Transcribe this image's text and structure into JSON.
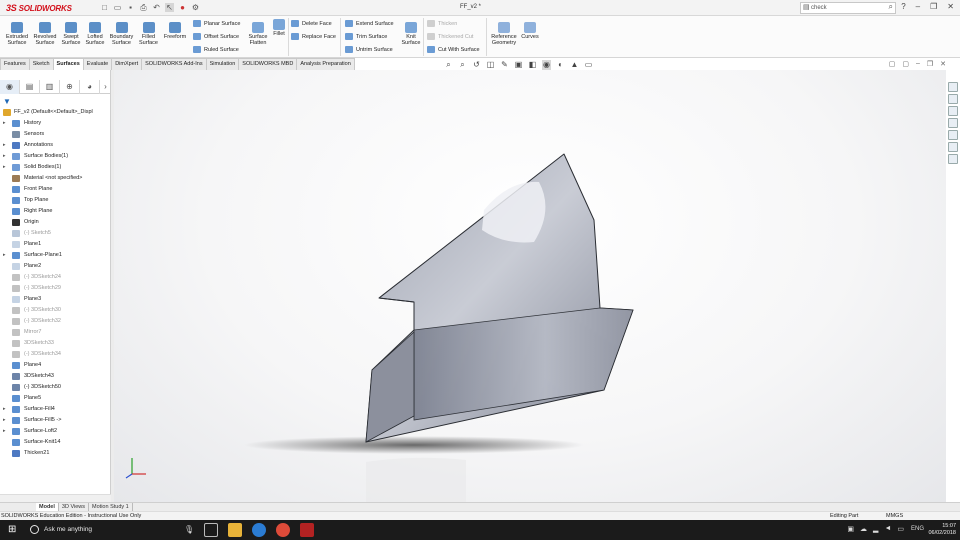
{
  "titlebar": {
    "brand": "SOLIDWORKS",
    "document_title": "FF_v2 *",
    "search_value": "check"
  },
  "ribbon": {
    "big_buttons": [
      {
        "label": "Extruded Surface"
      },
      {
        "label": "Revolved Surface"
      },
      {
        "label": "Swept Surface"
      },
      {
        "label": "Lofted Surface"
      },
      {
        "label": "Boundary Surface"
      },
      {
        "label": "Filled Surface"
      },
      {
        "label": "Freeform"
      }
    ],
    "col1": [
      "Planar Surface",
      "Offset Surface",
      "Ruled Surface"
    ],
    "flatten": "Surface Flatten",
    "fillet": "Fillet",
    "col2": [
      "Delete Face",
      "Replace Face"
    ],
    "col3": [
      "Extend Surface",
      "Trim Surface",
      "Untrim Surface"
    ],
    "knit": "Knit Surface",
    "col4": [
      "Thicken",
      "Thickened Cut",
      "Cut With Surface"
    ],
    "refgeom": "Reference Geometry",
    "curves": "Curves"
  },
  "tabs": [
    "Features",
    "Sketch",
    "Surfaces",
    "Evaluate",
    "DimXpert",
    "SOLIDWORKS Add-Ins",
    "Simulation",
    "SOLIDWORKS MBD",
    "Analysis Preparation"
  ],
  "active_tab": "Surfaces",
  "tree": {
    "root": "FF_v2  (Default<<Default>_Displ",
    "items": [
      {
        "label": "History",
        "dim": false,
        "expand": true,
        "icon": "history"
      },
      {
        "label": "Sensors",
        "dim": false,
        "expand": false,
        "icon": "sensor"
      },
      {
        "label": "Annotations",
        "dim": false,
        "expand": true,
        "icon": "annotation"
      },
      {
        "label": "Surface Bodies(1)",
        "dim": false,
        "expand": true,
        "icon": "surface-bodies"
      },
      {
        "label": "Solid Bodies(1)",
        "dim": false,
        "expand": true,
        "icon": "solid-bodies"
      },
      {
        "label": "Material <not specified>",
        "dim": false,
        "expand": false,
        "icon": "material"
      },
      {
        "label": "Front Plane",
        "dim": false,
        "expand": false,
        "icon": "plane"
      },
      {
        "label": "Top Plane",
        "dim": false,
        "expand": false,
        "icon": "plane"
      },
      {
        "label": "Right Plane",
        "dim": false,
        "expand": false,
        "icon": "plane"
      },
      {
        "label": "Origin",
        "dim": false,
        "expand": false,
        "icon": "origin"
      },
      {
        "label": "(-) Sketch5",
        "dim": true,
        "expand": false,
        "icon": "sketch"
      },
      {
        "label": "Plane1",
        "dim": false,
        "expand": false,
        "icon": "plane-outline"
      },
      {
        "label": "Surface-Plane1",
        "dim": false,
        "expand": true,
        "icon": "surface"
      },
      {
        "label": "Plane2",
        "dim": false,
        "expand": false,
        "icon": "plane-outline"
      },
      {
        "label": "(-) 3DSketch24",
        "dim": true,
        "expand": false,
        "icon": "3dsketch"
      },
      {
        "label": "(-) 3DSketch29",
        "dim": true,
        "expand": false,
        "icon": "3dsketch"
      },
      {
        "label": "Plane3",
        "dim": false,
        "expand": false,
        "icon": "plane-outline"
      },
      {
        "label": "(-) 3DSketch30",
        "dim": true,
        "expand": false,
        "icon": "3dsketch"
      },
      {
        "label": "(-) 3DSketch32",
        "dim": true,
        "expand": false,
        "icon": "3dsketch"
      },
      {
        "label": "Mirror7",
        "dim": true,
        "expand": false,
        "icon": "mirror"
      },
      {
        "label": "3DSketch33",
        "dim": true,
        "expand": false,
        "icon": "3dsketch"
      },
      {
        "label": "(-) 3DSketch34",
        "dim": true,
        "expand": false,
        "icon": "3dsketch"
      },
      {
        "label": "Plane4",
        "dim": false,
        "expand": false,
        "icon": "plane"
      },
      {
        "label": "3DSketch43",
        "dim": false,
        "expand": false,
        "icon": "3dsketch-active"
      },
      {
        "label": "(-) 3DSketch50",
        "dim": false,
        "expand": false,
        "icon": "3dsketch-active"
      },
      {
        "label": "Plane5",
        "dim": false,
        "expand": false,
        "icon": "plane"
      },
      {
        "label": "Surface-Fill4",
        "dim": false,
        "expand": true,
        "icon": "surface"
      },
      {
        "label": "Surface-Fill5 ->",
        "dim": false,
        "expand": true,
        "icon": "surface"
      },
      {
        "label": "Surface-Loft2",
        "dim": false,
        "expand": true,
        "icon": "surface"
      },
      {
        "label": "Surface-Knit14",
        "dim": false,
        "expand": false,
        "icon": "surface"
      },
      {
        "label": "Thicken21",
        "dim": false,
        "expand": false,
        "icon": "thicken"
      }
    ]
  },
  "bottom_tabs": [
    "Model",
    "3D Views",
    "Motion Study 1"
  ],
  "status": {
    "left": "SOLIDWORKS Education Edition - Instructional Use Only",
    "mode": "Editing Part",
    "units": "MMGS"
  },
  "taskbar": {
    "search_placeholder": "Ask me anything",
    "lang": "ENG",
    "time": "15:07",
    "date": "06/02/2018"
  }
}
